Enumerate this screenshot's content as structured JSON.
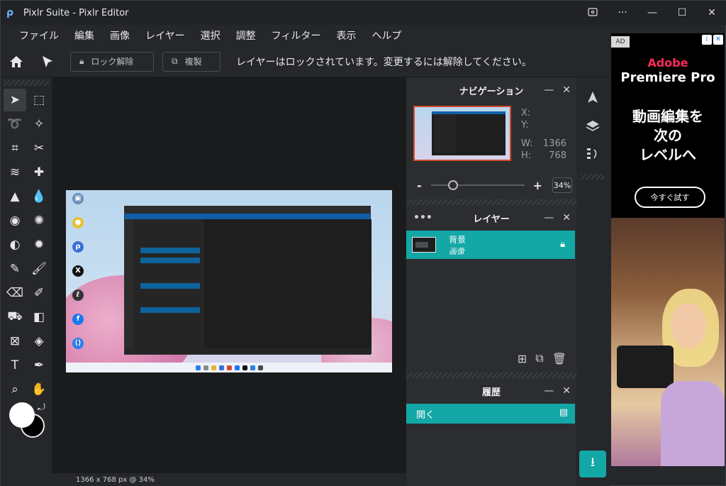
{
  "window": {
    "title": "Pixlr Suite - Pixlr Editor",
    "controls": [
      "cast-icon",
      "more-icon",
      "minimize-icon",
      "maximize-icon",
      "close-icon"
    ]
  },
  "menu": [
    "ファイル",
    "編集",
    "画像",
    "レイヤー",
    "選択",
    "調整",
    "フィルター",
    "表示",
    "ヘルプ"
  ],
  "toolbar": {
    "unlock_label": "ロック解除",
    "duplicate_label": "複製",
    "message": "レイヤーはロックされています。変更するには解除してください。"
  },
  "tools": [
    {
      "name": "arrange-tool-icon",
      "glyph": "➤"
    },
    {
      "name": "marquee-tool-icon",
      "glyph": "⬚"
    },
    {
      "name": "lasso-tool-icon",
      "glyph": "➰"
    },
    {
      "name": "wand-tool-icon",
      "glyph": "✧"
    },
    {
      "name": "crop-tool-icon",
      "glyph": "⌗"
    },
    {
      "name": "cutout-tool-icon",
      "glyph": "✂"
    },
    {
      "name": "liquify-tool-icon",
      "glyph": "≋"
    },
    {
      "name": "heal-tool-icon",
      "glyph": "✚"
    },
    {
      "name": "clone-tool-icon",
      "glyph": "▲"
    },
    {
      "name": "blur-tool-icon",
      "glyph": "💧"
    },
    {
      "name": "sponge-tool-icon",
      "glyph": "◉"
    },
    {
      "name": "color-replace-tool-icon",
      "glyph": "✺"
    },
    {
      "name": "dodge-tool-icon",
      "glyph": "◐"
    },
    {
      "name": "filter-brush-tool-icon",
      "glyph": "✹"
    },
    {
      "name": "pen-tool-icon",
      "glyph": "✎"
    },
    {
      "name": "brush-tool-icon",
      "glyph": "🖌"
    },
    {
      "name": "eraser-tool-icon",
      "glyph": "⌫"
    },
    {
      "name": "smudge-tool-icon",
      "glyph": "✐"
    },
    {
      "name": "fill-tool-icon",
      "glyph": "⛟"
    },
    {
      "name": "gradient-tool-icon",
      "glyph": "◧"
    },
    {
      "name": "image-placeholder-tool-icon",
      "glyph": "⊠"
    },
    {
      "name": "shape-tool-icon",
      "glyph": "◈"
    },
    {
      "name": "text-tool-icon",
      "glyph": "T"
    },
    {
      "name": "eyedropper-tool-icon",
      "glyph": "✒"
    },
    {
      "name": "zoom-tool-icon",
      "glyph": "⌕"
    },
    {
      "name": "hand-tool-icon",
      "glyph": "✋"
    }
  ],
  "colors": {
    "foreground": "#ffffff",
    "background": "#000000",
    "accent": "#13a7a6"
  },
  "status": "1366 x 768 px @ 34%",
  "navigation": {
    "title": "ナビゲーション",
    "x_label": "X:",
    "y_label": "Y:",
    "w_label": "W:",
    "h_label": "H:",
    "w_value": "1366",
    "h_value": "768",
    "zoom": "34%"
  },
  "layers": {
    "title": "レイヤー",
    "items": [
      {
        "name": "背景",
        "type": "画像",
        "locked": true
      }
    ]
  },
  "history": {
    "title": "履歴",
    "items": [
      "開く"
    ]
  },
  "ad": {
    "badge": "AD",
    "brand": "Adobe",
    "product": "Premiere Pro",
    "copy": [
      "動画編集を",
      "次の",
      "レベルへ"
    ],
    "cta": "今すぐ試す"
  }
}
